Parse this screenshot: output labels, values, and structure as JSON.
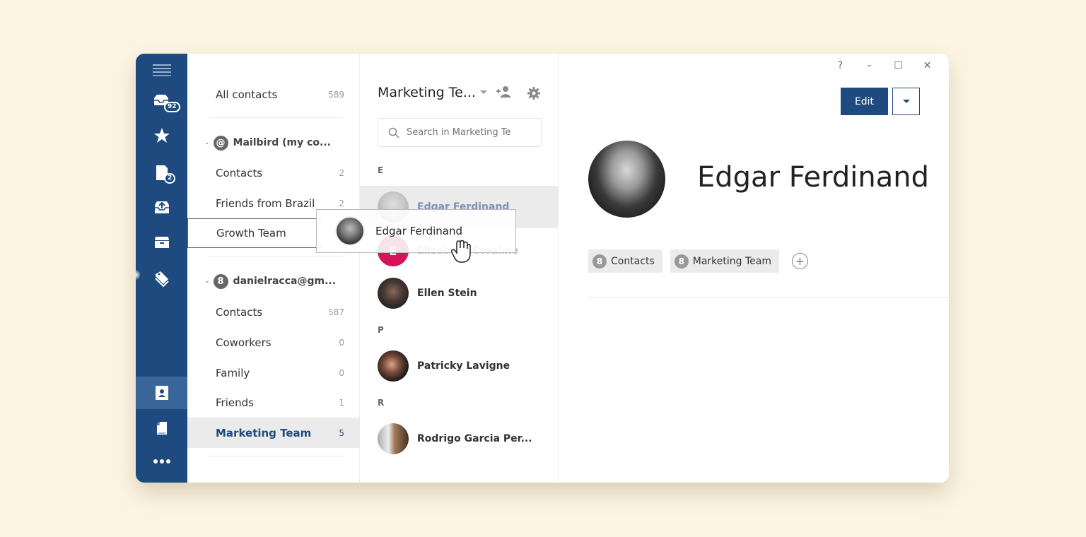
{
  "rail": {
    "items": [
      {
        "name": "menu",
        "icon": "hamburger-menu-icon"
      },
      {
        "name": "inbox",
        "icon": "inbox-stack-icon",
        "badge": "92"
      },
      {
        "name": "starred",
        "icon": "star-icon"
      },
      {
        "name": "drafts",
        "icon": "document-stack-icon",
        "badge": "2"
      },
      {
        "name": "sent",
        "icon": "outbox-tray-icon"
      },
      {
        "name": "archive",
        "icon": "archive-box-icon"
      },
      {
        "name": "tags",
        "icon": "tag-icon"
      },
      {
        "name": "contacts",
        "icon": "contact-card-icon",
        "active": true
      },
      {
        "name": "notes",
        "icon": "notes-icon"
      },
      {
        "name": "more",
        "icon": "more-dots-icon"
      }
    ]
  },
  "folders": {
    "all": {
      "label": "All contacts",
      "count": "589"
    },
    "accounts": [
      {
        "name": "Mailbird (my co...",
        "icon_letter": "@",
        "groups": [
          {
            "label": "Contacts",
            "count": "2"
          },
          {
            "label": "Friends from Brazil",
            "count": "2"
          },
          {
            "label": "Growth Team",
            "count": ""
          }
        ]
      },
      {
        "name": "danielracca@gm...",
        "icon_letter": "8",
        "groups": [
          {
            "label": "Contacts",
            "count": "587"
          },
          {
            "label": "Coworkers",
            "count": "0"
          },
          {
            "label": "Family",
            "count": "0"
          },
          {
            "label": "Friends",
            "count": "1"
          },
          {
            "label": "Marketing Team",
            "count": "5"
          }
        ]
      }
    ]
  },
  "contact_list": {
    "title": "Marketing Te...",
    "search_placeholder": "Search in Marketing Te",
    "sections": [
      {
        "letter": "E",
        "contacts": [
          "Edgar Ferdinand",
          "Elizabeth Coraline",
          "Ellen Stein"
        ]
      },
      {
        "letter": "P",
        "contacts": [
          "Patricky Lavigne"
        ]
      },
      {
        "letter": "R",
        "contacts": [
          "Rodrigo Garcia Per..."
        ]
      }
    ],
    "elizabeth_initial": "E",
    "avatar_colors": {
      "elizabeth": "#d4145a"
    }
  },
  "drag": {
    "label": "Edgar Ferdinand"
  },
  "window_controls": {
    "help": "?",
    "minimize": "–",
    "maximize": "☐",
    "close": "✕"
  },
  "detail": {
    "name": "Edgar Ferdinand",
    "edit_label": "Edit",
    "groups": [
      {
        "label": "Contacts",
        "icon_letter": "8"
      },
      {
        "label": "Marketing Team",
        "icon_letter": "8"
      }
    ],
    "add_group": "+"
  },
  "colors": {
    "brand": "#1f4a80",
    "background": "#fdf4e3"
  }
}
